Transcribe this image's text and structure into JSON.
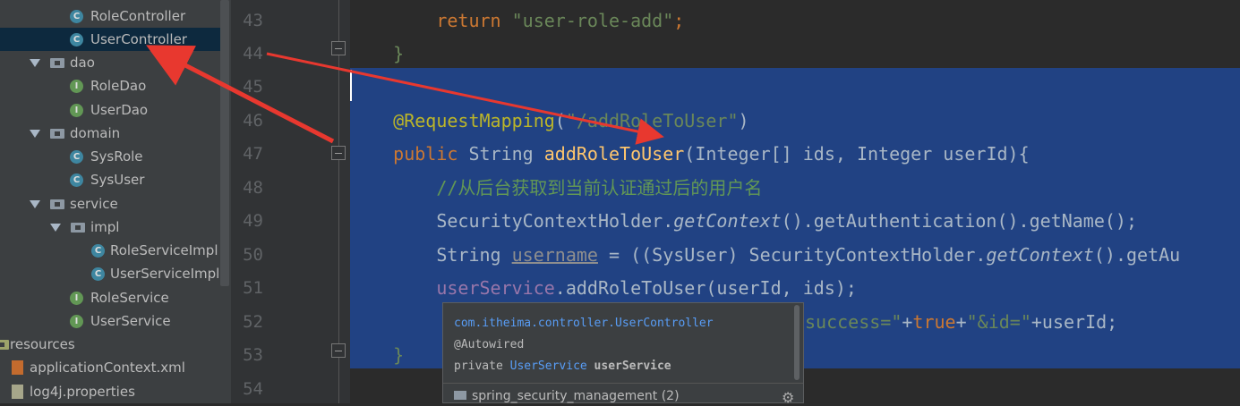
{
  "tree": {
    "items": [
      {
        "label": "RoleController",
        "icon": "class-icon",
        "badge": "C"
      },
      {
        "label": "UserController",
        "icon": "class-icon",
        "badge": "C",
        "selected": true
      },
      {
        "label": "dao",
        "icon": "package-folder-icon"
      },
      {
        "label": "RoleDao",
        "icon": "interface-icon",
        "badge": "I"
      },
      {
        "label": "UserDao",
        "icon": "interface-icon",
        "badge": "I"
      },
      {
        "label": "domain",
        "icon": "package-folder-icon"
      },
      {
        "label": "SysRole",
        "icon": "class-icon",
        "badge": "C"
      },
      {
        "label": "SysUser",
        "icon": "class-icon",
        "badge": "C"
      },
      {
        "label": "service",
        "icon": "package-folder-icon"
      },
      {
        "label": "impl",
        "icon": "package-folder-icon"
      },
      {
        "label": "RoleServiceImpl",
        "icon": "class-icon",
        "badge": "C"
      },
      {
        "label": "UserServiceImpl",
        "icon": "class-icon",
        "badge": "C"
      },
      {
        "label": "RoleService",
        "icon": "interface-icon",
        "badge": "I"
      },
      {
        "label": "UserService",
        "icon": "interface-icon",
        "badge": "I"
      },
      {
        "label": "resources",
        "icon": "resources-folder-icon"
      },
      {
        "label": "applicationContext.xml",
        "icon": "xml-file-icon"
      },
      {
        "label": "log4j.properties",
        "icon": "properties-file-icon"
      }
    ]
  },
  "editor": {
    "line_numbers": [
      "43",
      "44",
      "45",
      "46",
      "47",
      "48",
      "49",
      "50",
      "51",
      "52",
      "53",
      "54"
    ],
    "line43": {
      "kw": "return",
      "str": "\"user-role-add\"",
      "end": ";"
    },
    "line44": {
      "brace": "}"
    },
    "line46": {
      "ann": "@RequestMapping",
      "p1": "(",
      "str": "\"/addRoleToUser\"",
      "p2": ")"
    },
    "line47": {
      "kw": "public",
      "type": " String ",
      "fn": "addRoleToUser",
      "params": "(Integer[] ids, Integer userId){"
    },
    "line48": {
      "comment": "//从后台获取到当前认证通过后的用户名"
    },
    "line49": {
      "cls": "SecurityContextHolder.",
      "static_call": "getContext",
      "rest": "().getAuthentication().getName();"
    },
    "line50": {
      "pre": "String ",
      "var": "username",
      "mid": " = ((SysUser) SecurityContextHolder.",
      "static_call": "getContext",
      "rest": "().getAu"
    },
    "line51": {
      "field": "userService",
      "rest": ".addRoleToUser(userId, ids);"
    },
    "line52": {
      "str1": "success=\"",
      "op1": "+",
      "kw": "true",
      "op2": "+",
      "str2": "\"&id=\"",
      "rest": "+userId;"
    },
    "line53": {
      "brace": "}"
    }
  },
  "tooltip": {
    "line1": "com.itheima.controller.UserController",
    "line2": "@Autowired",
    "line3_kw": "private ",
    "line3_type": "UserService",
    "line3_name": " userService",
    "footer": "spring_security_management (2)"
  },
  "colors": {
    "selection": "#214283",
    "annotation_arrow": "#e8382f"
  }
}
